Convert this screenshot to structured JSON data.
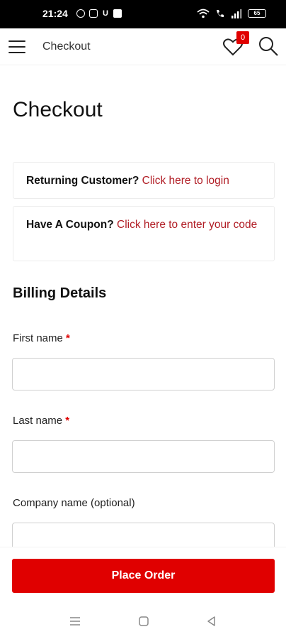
{
  "status_bar": {
    "time": "21:24",
    "battery": "65",
    "left_icons": [
      "whatsapp-icon",
      "instagram-icon",
      "app-u-icon",
      "notification-icon"
    ],
    "right_icons": [
      "wifi-icon",
      "vowifi-icon",
      "signal-icon",
      "battery-icon"
    ]
  },
  "app_bar": {
    "title": "Checkout",
    "wishlist_count": "0"
  },
  "page": {
    "title": "Checkout"
  },
  "notices": {
    "returning_label": "Returning Customer?",
    "returning_link": "Click here to login",
    "coupon_label": "Have A Coupon?",
    "coupon_link": "Click here to enter your code"
  },
  "billing": {
    "title": "Billing Details",
    "fields": [
      {
        "label": "First name",
        "required_mark": "*",
        "value": ""
      },
      {
        "label": "Last name",
        "required_mark": "*",
        "value": ""
      },
      {
        "label": "Company name (optional)",
        "required_mark": "",
        "value": ""
      }
    ]
  },
  "actions": {
    "place_order": "Place Order"
  },
  "colors": {
    "accent": "#e00000",
    "link": "#b11d25"
  }
}
